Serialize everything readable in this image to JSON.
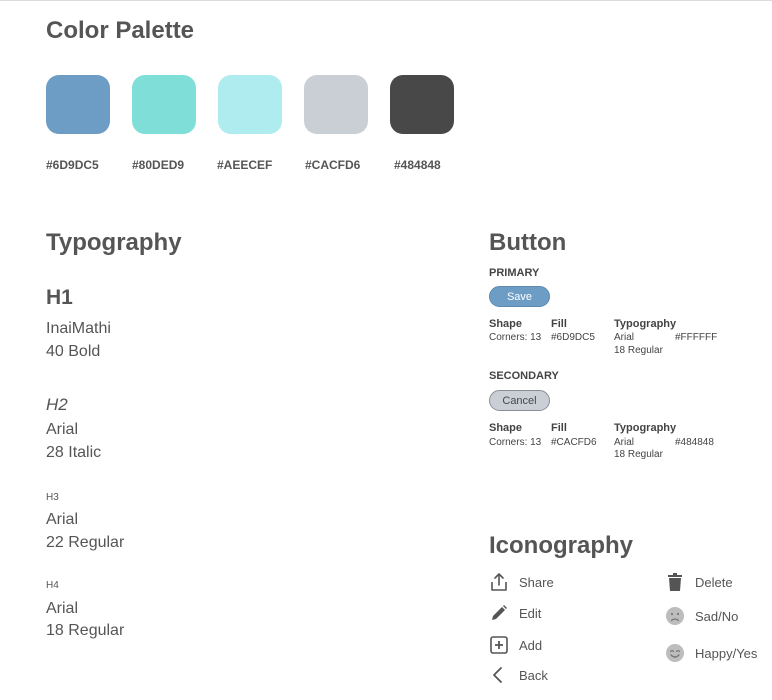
{
  "color_palette": {
    "title": "Color Palette",
    "swatches": [
      {
        "hex": "#6D9DC5",
        "label": "#6D9DC5"
      },
      {
        "hex": "#80DED9",
        "label": "#80DED9"
      },
      {
        "hex": "#AEECEF",
        "label": "#AEECEF"
      },
      {
        "hex": "#CACFD6",
        "label": "#CACFD6"
      },
      {
        "hex": "#484848",
        "label": "#484848"
      }
    ]
  },
  "typography": {
    "title": "Typography",
    "h1": {
      "label": "H1",
      "font": "InaiMathi",
      "spec": "40 Bold"
    },
    "h2": {
      "label": "H2",
      "font": "Arial",
      "spec": "28 Italic"
    },
    "h3": {
      "label": "H3",
      "font": "Arial",
      "spec": "22 Regular"
    },
    "h4": {
      "label": "H4",
      "font": "Arial",
      "spec": "18 Regular"
    }
  },
  "button": {
    "title": "Button",
    "primary": {
      "caption": "PRIMARY",
      "label": "Save",
      "shape_head": "Shape",
      "shape_val": "Corners: 13",
      "fill_head": "Fill",
      "fill_val": "#6D9DC5",
      "typo_head": "Typography",
      "typo_font": "Arial",
      "typo_color": "#FFFFFF",
      "typo_spec": "18 Regular"
    },
    "secondary": {
      "caption": "SECONDARY",
      "label": "Cancel",
      "shape_head": "Shape",
      "shape_val": "Corners: 13",
      "fill_head": "Fill",
      "fill_val": "#CACFD6",
      "typo_head": "Typography",
      "typo_font": "Arial",
      "typo_color": "#484848",
      "typo_spec": "18 Regular"
    }
  },
  "iconography": {
    "title": "Iconography",
    "left": [
      {
        "icon": "share-icon",
        "label": "Share"
      },
      {
        "icon": "edit-icon",
        "label": "Edit"
      },
      {
        "icon": "add-icon",
        "label": "Add"
      },
      {
        "icon": "back-icon",
        "label": "Back"
      }
    ],
    "right": [
      {
        "icon": "delete-icon",
        "label": "Delete"
      },
      {
        "icon": "sad-icon",
        "label": "Sad/No"
      },
      {
        "icon": "happy-icon",
        "label": "Happy/Yes"
      }
    ]
  }
}
